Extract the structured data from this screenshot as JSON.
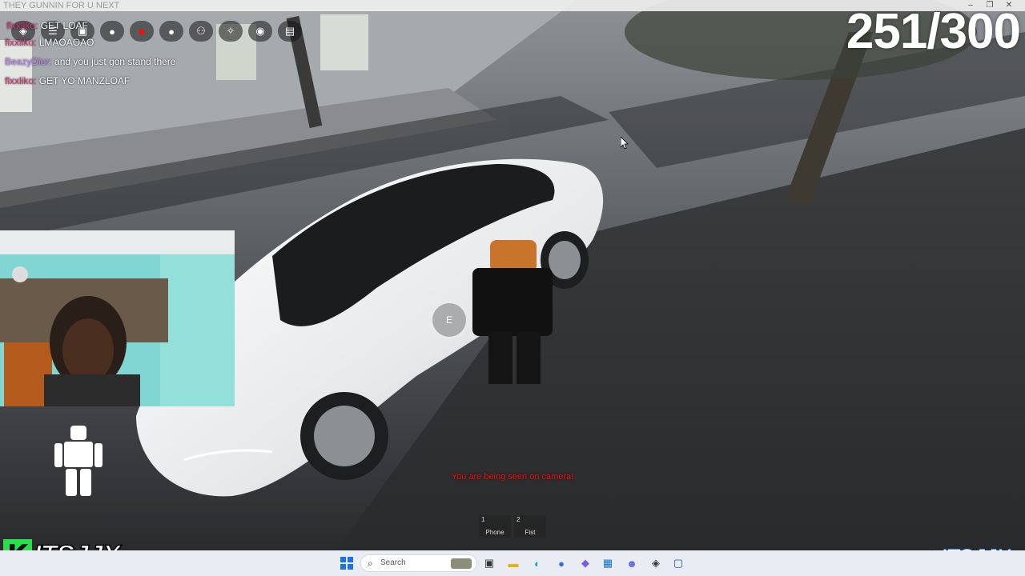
{
  "titlebar": {
    "text": "THEY GUNNIN FOR U NEXT",
    "minimize_icon": "minimize-icon",
    "maximize_icon": "maximize-icon",
    "close_icon": "close-icon"
  },
  "chat": {
    "lines": [
      {
        "user": "flxxliko:",
        "message": "GET LOAF",
        "user_color": "#d23c7a"
      },
      {
        "user": "flxxliko:",
        "message": "LMAOAOAO",
        "user_color": "#d23c7a"
      },
      {
        "user": "BeazyDior:",
        "message": "and you just gon stand there",
        "user_color": "#c58cff"
      },
      {
        "user": "flxxliko:",
        "message": "GET YO MANZLOAF",
        "user_color": "#d23c7a"
      }
    ]
  },
  "topbar": {
    "icons": [
      "roblox-menu-icon",
      "chat-icon",
      "backpack-icon",
      "record-icon",
      "person-icon",
      "friends-icon",
      "emote-icon",
      "camera-icon",
      "inventory-icon"
    ]
  },
  "counter": "251/300",
  "prompt": {
    "key": "E"
  },
  "warning": "You are being seen on camera!",
  "hotbar": [
    {
      "num": "1",
      "label": "Phone"
    },
    {
      "num": "2",
      "label": "Fist"
    }
  ],
  "branding": {
    "left_k": "K",
    "left_text": "ITSJJX",
    "right_text": "ITSJJX_"
  },
  "taskbar": {
    "search_placeholder": "Search",
    "icons": [
      "windows-start-icon",
      "search-icon",
      "task-view-icon",
      "file-explorer-icon",
      "edge-icon",
      "app-icon",
      "discord-icon",
      "roblox-icon",
      "store-icon",
      "app2-icon"
    ]
  },
  "colors": {
    "warning": "#e01818",
    "brand_green": "#27e04b",
    "taskbar_bg": "#e9edf3"
  }
}
